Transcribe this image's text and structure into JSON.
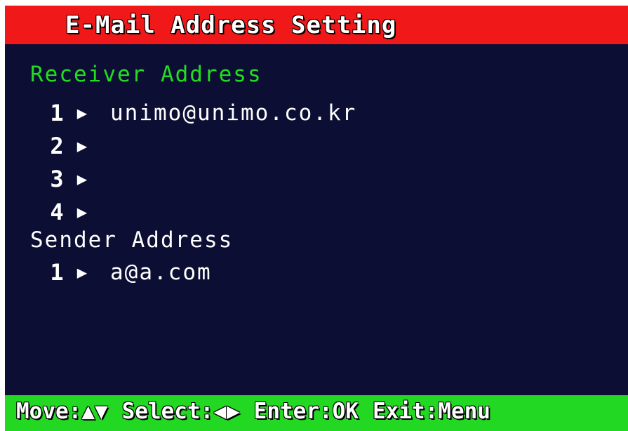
{
  "title": "E-Mail Address Setting",
  "receiver": {
    "label": "Receiver Address",
    "items": [
      {
        "index": "1",
        "arrow": "▶",
        "email": "unimo@unimo.co.kr"
      },
      {
        "index": "2",
        "arrow": "▶",
        "email": ""
      },
      {
        "index": "3",
        "arrow": "▶",
        "email": ""
      },
      {
        "index": "4",
        "arrow": "▶",
        "email": ""
      }
    ]
  },
  "sender": {
    "label": "Sender Address",
    "items": [
      {
        "index": "1",
        "arrow": "▶",
        "email": "a@a.com"
      }
    ]
  },
  "footer": {
    "move_label": "Move:",
    "move_up_glyph": "▲",
    "move_down_glyph": "▼",
    "select_label": "Select:",
    "select_left_glyph": "◀",
    "select_right_glyph": "▶",
    "enter_label": "Enter:OK",
    "exit_label": "Exit:Menu"
  },
  "colors": {
    "title_bar": "#f01818",
    "background": "#0c0f33",
    "footer_bar": "#22d822",
    "receiver_label": "#22dd22",
    "text": "#ffffff"
  }
}
